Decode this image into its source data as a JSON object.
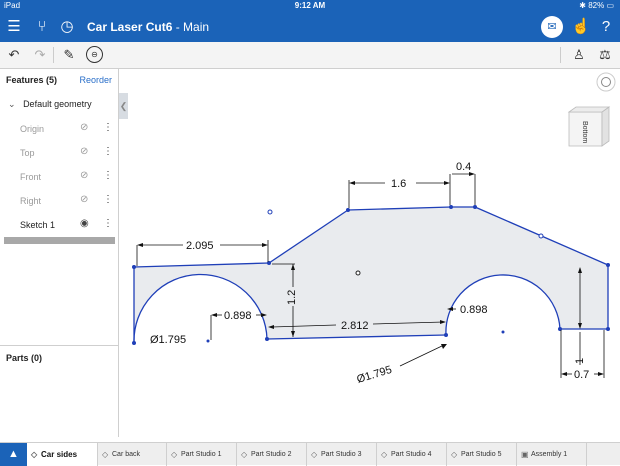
{
  "status": {
    "carrier": "iPad",
    "time": "9:12 AM",
    "battery": "82%"
  },
  "app": {
    "doc_title": "Car Laser Cut6",
    "branch": "- Main"
  },
  "panel": {
    "features_header": "Features (5)",
    "reorder_label": "Reorder",
    "group_label": "Default geometry",
    "items": [
      {
        "label": "Origin"
      },
      {
        "label": "Top"
      },
      {
        "label": "Front"
      },
      {
        "label": "Right"
      },
      {
        "label": "Sketch 1"
      }
    ],
    "parts_header": "Parts (0)"
  },
  "view_cube": {
    "face_label": "Bottom"
  },
  "dimensions": {
    "d_2095": "2.095",
    "d_16": "1.6",
    "d_04": "0.4",
    "d_12": "1.2",
    "d_0898_left": "0.898",
    "d_0898_right": "0.898",
    "d_2812": "2.812",
    "d_dia_left": "Ø1.795",
    "d_dia_right": "Ø1.795",
    "d_1": "1",
    "d_07": "0.7"
  },
  "tabs": [
    {
      "label": "Car sides"
    },
    {
      "label": "Car back"
    },
    {
      "label": "Part Studio 1"
    },
    {
      "label": "Part Studio 2"
    },
    {
      "label": "Part Studio 3"
    },
    {
      "label": "Part Studio 4"
    },
    {
      "label": "Part Studio 5"
    },
    {
      "label": "Assembly 1"
    }
  ],
  "colors": {
    "accent": "#1b63b8",
    "sketch": "#1f3fb8",
    "fill": "#e9ebee"
  }
}
